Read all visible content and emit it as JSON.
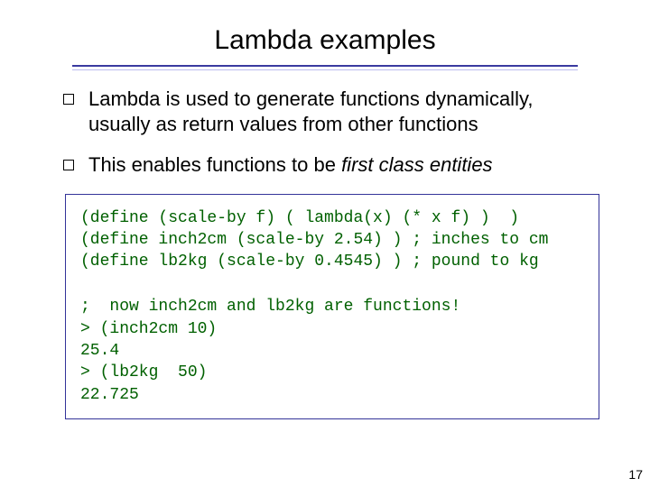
{
  "title": "Lambda examples",
  "bullets": [
    {
      "text": "Lambda is used to generate functions dynamically, usually as return values from other functions"
    },
    {
      "prefix": "This enables functions to be ",
      "emphasis": "first class entities"
    }
  ],
  "code": {
    "lines_top": [
      "(define (scale-by f) ( lambda(x) (* x f) )  )",
      "(define inch2cm (scale-by 2.54) ) ; inches to cm",
      "(define lb2kg (scale-by 0.4545) ) ; pound to kg"
    ],
    "lines_bottom": [
      ";  now inch2cm and lb2kg are functions!",
      "> (inch2cm 10)",
      "25.4",
      "> (lb2kg  50)",
      "22.725"
    ]
  },
  "page_number": "17"
}
